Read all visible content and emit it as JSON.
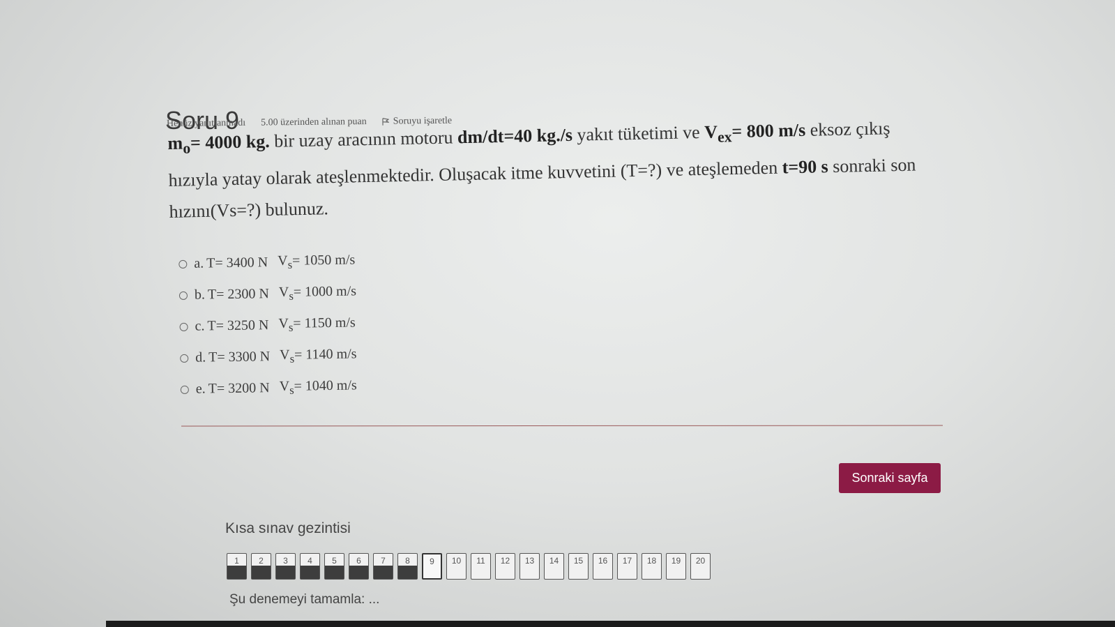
{
  "question": {
    "title": "Soru 9",
    "status": "Henüz yanıtlanmadı",
    "grade": "5.00 üzerinden alınan puan",
    "flag_label": "Soruyu işaretle",
    "text_parts": {
      "m0": "m",
      "m0_sub": "o",
      "m0_value": "= 4000 kg.",
      "p1": " bir uzay aracının motoru ",
      "dmdt": "dm/dt=40 kg./s",
      "p2": " yakıt tüketimi ve ",
      "vex": "V",
      "vex_sub": "ex",
      "vex_value": "= 800 m/s",
      "p3": " eksoz çıkış hızıyla yatay olarak ateşlenmektedir.  Oluşacak itme kuvvetini (T=?) ve ateşlemeden ",
      "t": "t=90 s",
      "p4": " sonraki son hızını(Vs=?) bulunuz."
    }
  },
  "answers": [
    {
      "letter": "a.",
      "t": "T= 3400 N",
      "v": "V",
      "v_sub": "s",
      "v_value": "= 1050 m/s"
    },
    {
      "letter": "b.",
      "t": "T= 2300 N",
      "v": "V",
      "v_sub": "s",
      "v_value": "= 1000 m/s"
    },
    {
      "letter": "c.",
      "t": "T= 3250 N",
      "v": "V",
      "v_sub": "s",
      "v_value": "= 1150 m/s"
    },
    {
      "letter": "d.",
      "t": "T= 3300 N",
      "v": "V",
      "v_sub": "s",
      "v_value": "= 1140 m/s"
    },
    {
      "letter": "e.",
      "t": "T= 3200 N",
      "v": "V",
      "v_sub": "s",
      "v_value": "= 1040 m/s"
    }
  ],
  "next_button": "Sonraki sayfa",
  "navigation": {
    "title": "Kısa sınav gezintisi",
    "blocks": [
      "1",
      "2",
      "3",
      "4",
      "5",
      "6",
      "7",
      "8",
      "9",
      "10",
      "11",
      "12",
      "13",
      "14",
      "15",
      "16",
      "17",
      "18",
      "19",
      "20"
    ],
    "finish_link": "Şu denemeyi tamamla: ..."
  },
  "colors": {
    "accent": "#8c1b45"
  }
}
